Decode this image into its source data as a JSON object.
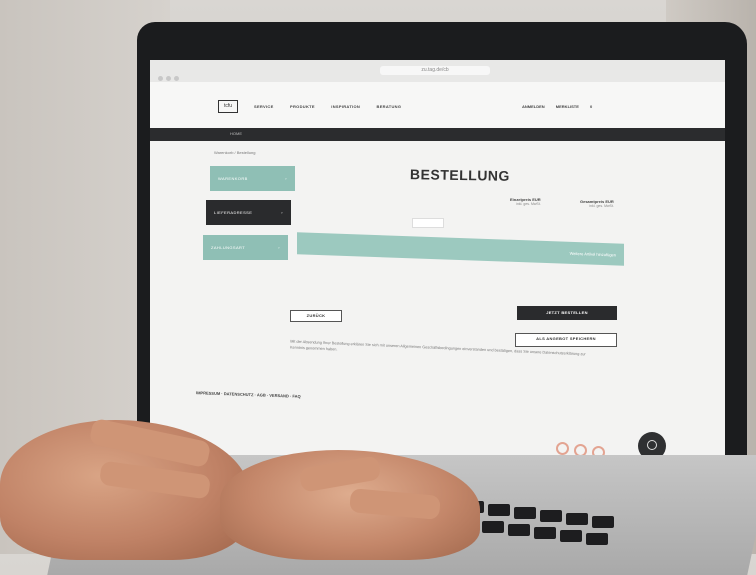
{
  "browser": {
    "url_text": "zu.tag.de/cb"
  },
  "header": {
    "logo_text": "tcfu",
    "nav": [
      "SERVICE",
      "PRODUKTE",
      "INSPIRATION",
      "BERATUNG"
    ],
    "nav_right": [
      "ANMELDEN",
      "MERKLISTE",
      "0"
    ]
  },
  "strip": {
    "label": "HOME"
  },
  "breadcrumb": "Warenkorb / Bestellung",
  "sidebar": {
    "items": [
      {
        "label": "WARENKORB"
      },
      {
        "label": "LIEFERADRESSE"
      },
      {
        "label": "ZAHLUNGSART"
      }
    ]
  },
  "main": {
    "title": "BESTELLUNG",
    "col1": {
      "label": "Einzelpreis EUR",
      "sub": "inkl. ges. MwSt."
    },
    "col2": {
      "label": "Gesamtpreis EUR",
      "sub": "inkl. ges. MwSt."
    },
    "teal_bar_label": "Weitere Artikel hinzufügen",
    "back_button": "ZURÜCK",
    "buy_button": "JETZT BESTELLEN",
    "offer_button": "ALS ANGEBOT SPEICHERN",
    "notice": "Mit der Absendung Ihrer Bestellung erklären Sie sich mit unseren Allgemeinen Geschäftsbedingungen einverstanden und bestätigen, dass Sie unsere Datenschutzerklärung zur Kenntnis genommen haben."
  },
  "footer": {
    "links": "IMPRESSUM · DATENSCHUTZ · AGB · VERSAND · FAQ"
  },
  "colors": {
    "teal": "#8fbfb5",
    "dark": "#2a2b2d",
    "social": "#e3a492"
  },
  "icons": [
    "facebook-icon",
    "instagram-icon",
    "pinterest-icon",
    "chat-icon"
  ]
}
